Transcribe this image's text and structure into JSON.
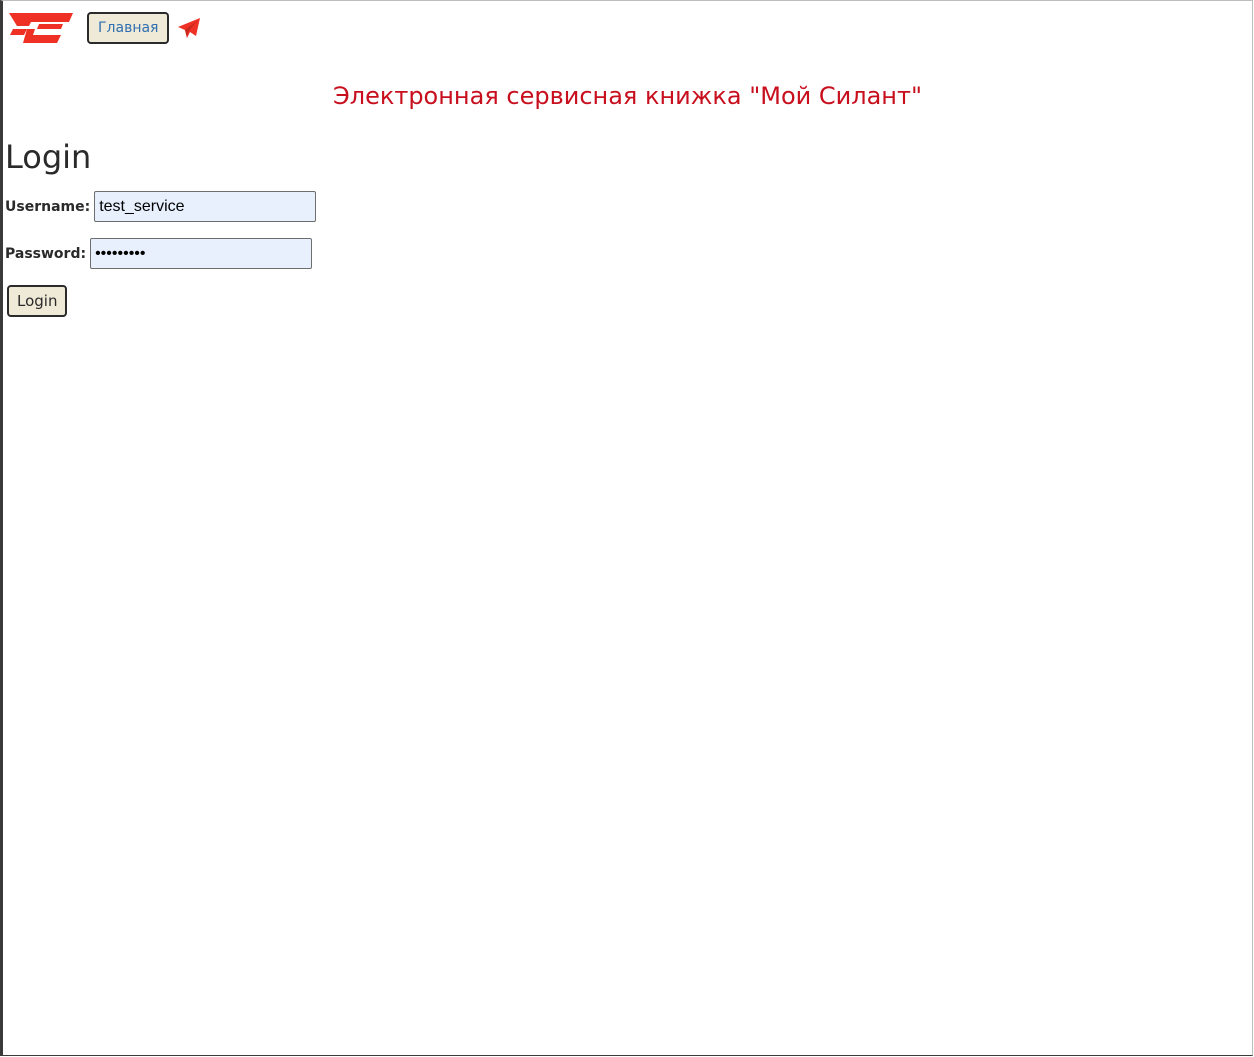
{
  "header": {
    "logo_icon": "silant-logo-icon",
    "brand_color": "#ee3124",
    "home_label": "Главная",
    "telegram_icon": "telegram-icon"
  },
  "site_title": "Электронная сервисная книжка \"Мой Силант\"",
  "title_color": "#c80f1e",
  "login_form": {
    "heading": "Login",
    "username_label": "Username:",
    "username_value": "test_service",
    "password_label": "Password:",
    "password_value": "•••••••••",
    "submit_label": "Login"
  }
}
